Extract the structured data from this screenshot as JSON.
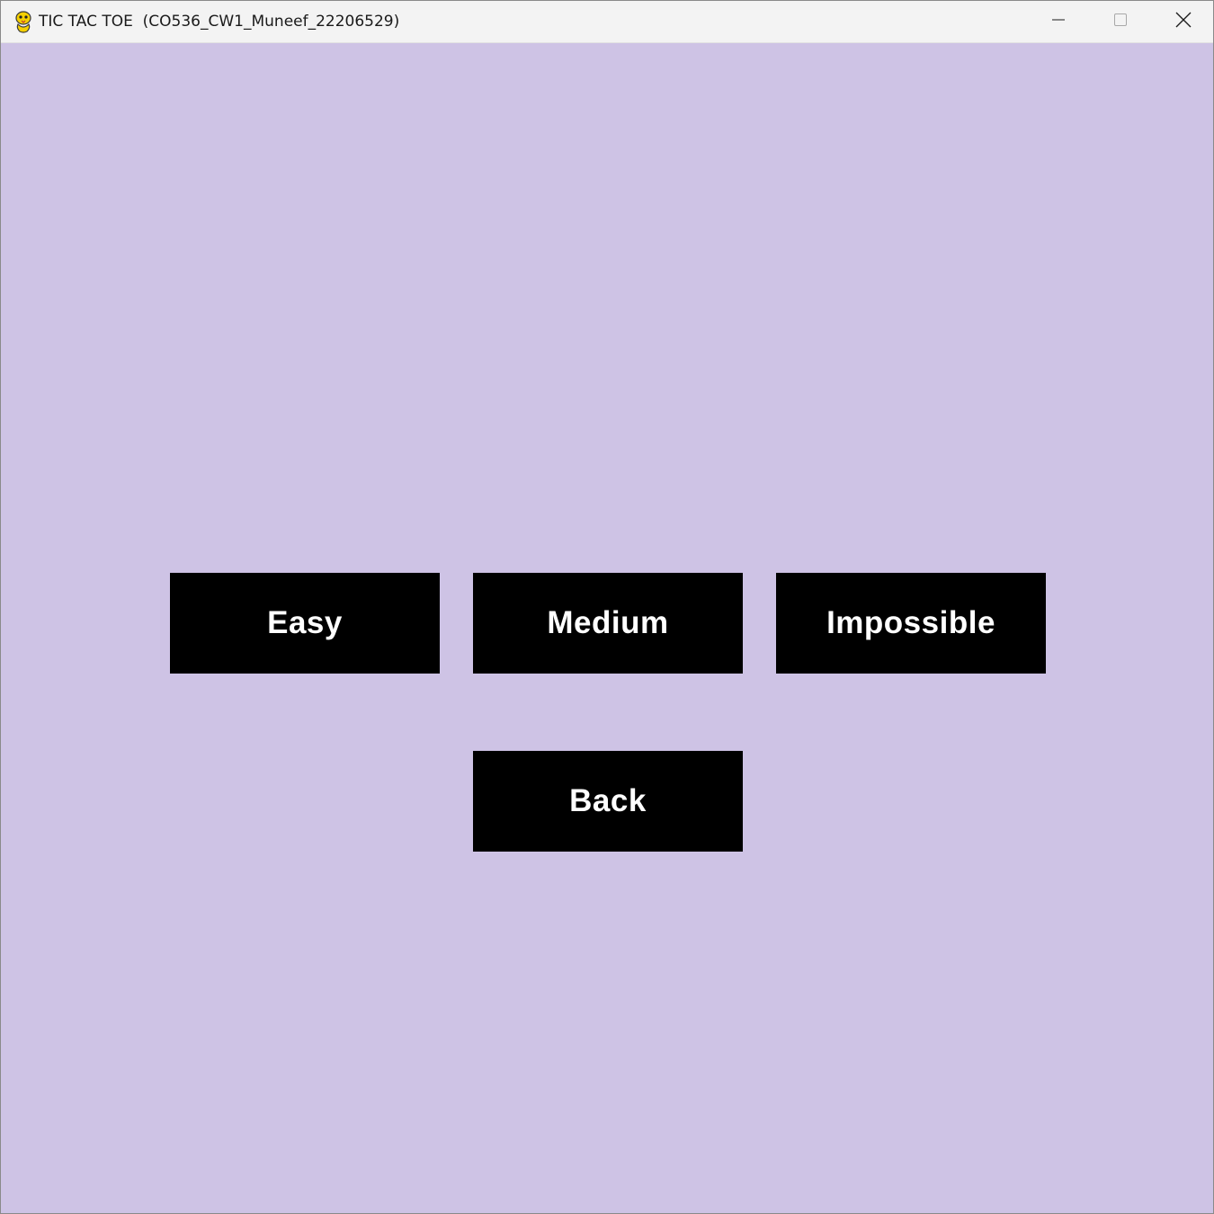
{
  "window": {
    "title": "TIC TAC TOE  (CO536_CW1_Muneef_22206529)",
    "app_icon": "pygame-snake-icon",
    "controls": {
      "minimize_icon": "minimize-icon",
      "maximize_icon": "maximize-icon",
      "close_icon": "close-icon"
    }
  },
  "menu": {
    "difficulty_buttons": [
      {
        "label": "Easy"
      },
      {
        "label": "Medium"
      },
      {
        "label": "Impossible"
      }
    ],
    "back_label": "Back"
  },
  "colors": {
    "background": "#cec3e5",
    "button_bg": "#000000",
    "button_text": "#ffffff",
    "titlebar": "#f3f3f3"
  }
}
